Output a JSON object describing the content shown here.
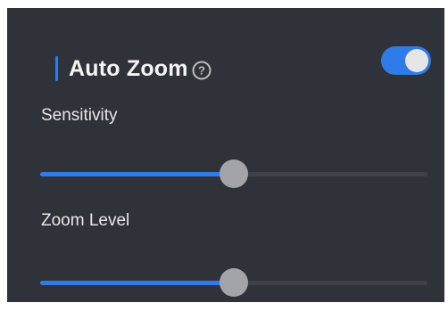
{
  "panel": {
    "title": "Auto Zoom",
    "help_icon": "help-question-icon",
    "auto_zoom_enabled": true,
    "colors": {
      "background": "#2f3238",
      "accent": "#2f7bea",
      "track": "#3f4249",
      "thumb": "#a3a4a8"
    }
  },
  "settings": {
    "sensitivity": {
      "label": "Sensitivity",
      "value_fraction": 0.5
    },
    "zoom_level": {
      "label": "Zoom Level",
      "value_fraction": 0.5
    }
  }
}
